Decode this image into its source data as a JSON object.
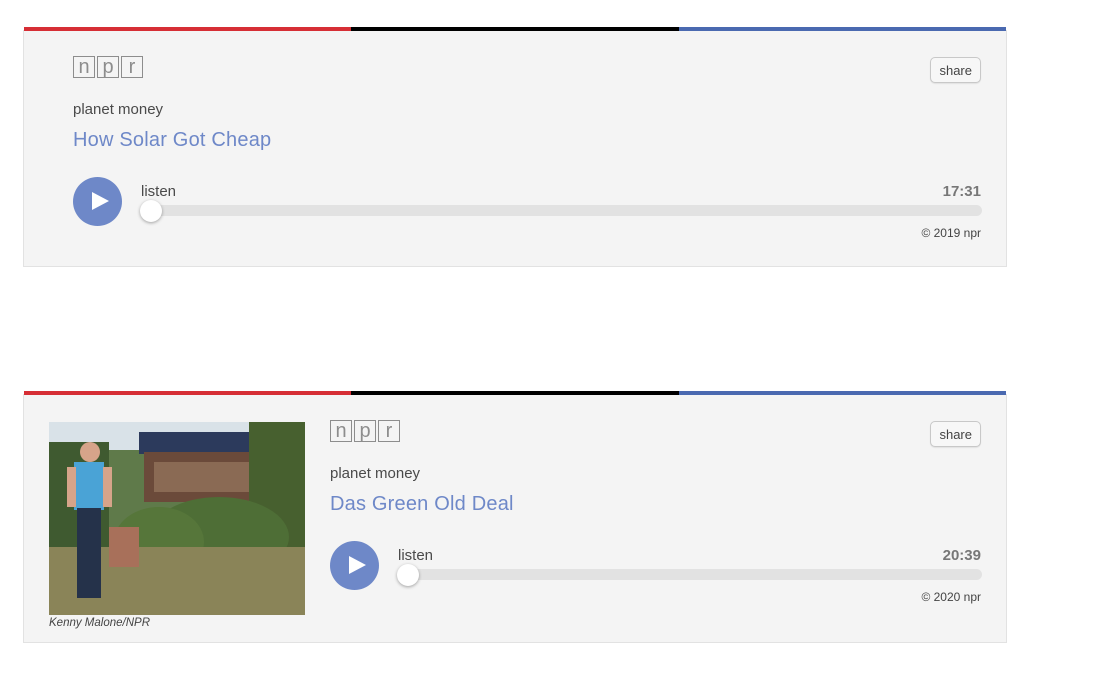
{
  "theme": {
    "stripe_colors": [
      "#d62e35",
      "#000000",
      "#4a69b0"
    ],
    "link_color": "#6e88c8",
    "play_color": "#6e88c8"
  },
  "players": [
    {
      "logo_letters": [
        "n",
        "p",
        "r"
      ],
      "share_label": "share",
      "program": "planet money",
      "title": "How Solar Got Cheap",
      "listen_label": "listen",
      "duration": "17:31",
      "progress": 0,
      "copyright": "© 2019 npr"
    },
    {
      "logo_letters": [
        "n",
        "p",
        "r"
      ],
      "share_label": "share",
      "program": "planet money",
      "title": "Das Green Old Deal",
      "listen_label": "listen",
      "duration": "20:39",
      "progress": 0,
      "copyright": "© 2020 npr",
      "photo_credit": "Kenny Malone/NPR"
    }
  ]
}
